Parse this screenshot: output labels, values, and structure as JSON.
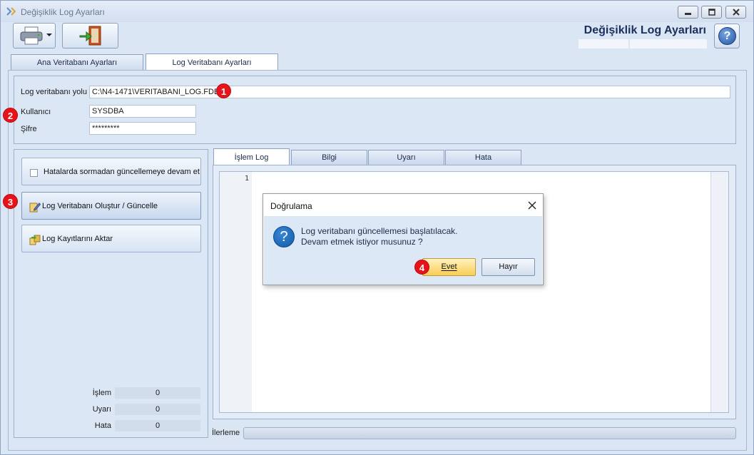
{
  "window": {
    "title": "Değişiklik Log Ayarları",
    "form_title": "Değişiklik Log Ayarları"
  },
  "toolbar": {
    "print_icon": "printer-icon",
    "exit_icon": "exit-door-icon",
    "help_glyph": "?"
  },
  "main_tabs": [
    {
      "label": "Ana Veritabanı Ayarları",
      "active": false
    },
    {
      "label": "Log Veritabanı Ayarları",
      "active": true
    }
  ],
  "db_settings": {
    "path_label": "Log veritabanı yolu",
    "path_value": "C:\\N4-1471\\VERITABANI_LOG.FDB",
    "user_label": "Kullanıcı",
    "user_value": "SYSDBA",
    "password_label": "Şifre",
    "password_value": "*********"
  },
  "actions": {
    "continue_on_error": {
      "label": "Hatalarda sormadan güncellemeye devam et",
      "checked": false
    },
    "create_update": "Log Veritabanı Oluştur / Güncelle",
    "transfer": "Log Kayıtlarını Aktar"
  },
  "stats": [
    {
      "label": "İşlem",
      "value": "0"
    },
    {
      "label": "Uyarı",
      "value": "0"
    },
    {
      "label": "Hata",
      "value": "0"
    }
  ],
  "log_tabs": [
    {
      "label": "İşlem Log",
      "active": true
    },
    {
      "label": "Bilgi",
      "active": false
    },
    {
      "label": "Uyarı",
      "active": false
    },
    {
      "label": "Hata",
      "active": false
    }
  ],
  "editor": {
    "line_numbers": [
      "1"
    ],
    "content": ""
  },
  "progress": {
    "label": "İlerleme",
    "value": 0
  },
  "dialog": {
    "title": "Doğrulama",
    "icon_glyph": "?",
    "message_line1": "Log veritabanı güncellemesi başlatılacak.",
    "message_line2": "Devam etmek istiyor musunuz ?",
    "yes_label": "Evet",
    "no_label": "Hayır"
  },
  "markers": [
    "1",
    "2",
    "3",
    "4"
  ],
  "colors": {
    "marker": "#e8131a",
    "accent": "#1b2f5e",
    "yes_button": "#f9cd55"
  }
}
